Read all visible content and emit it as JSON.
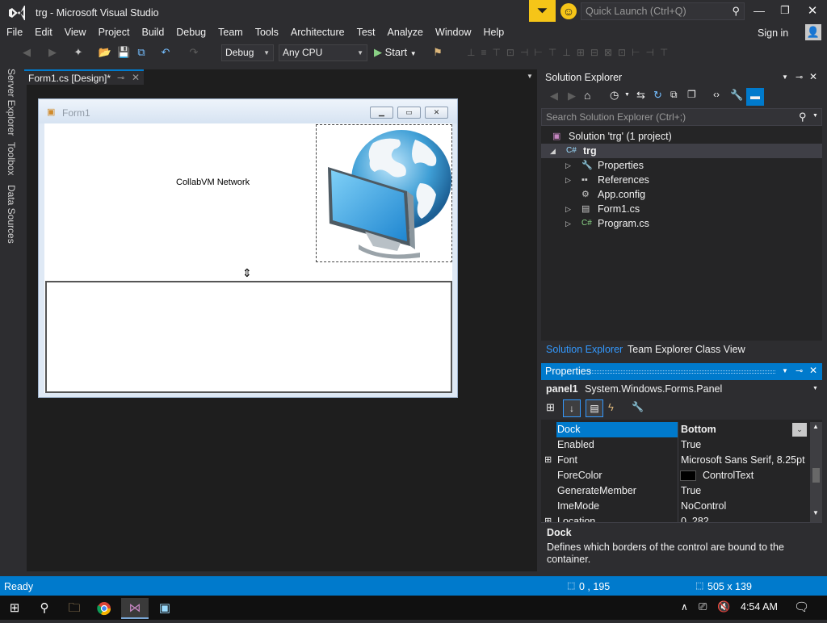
{
  "titlebar": {
    "app_title": "trg - Microsoft Visual Studio",
    "quick_launch_placeholder": "Quick Launch (Ctrl+Q)",
    "signin": "Sign in"
  },
  "menu": [
    "File",
    "Edit",
    "View",
    "Project",
    "Build",
    "Debug",
    "Team",
    "Tools",
    "Architecture",
    "Test",
    "Analyze",
    "Window",
    "Help"
  ],
  "toolbar": {
    "config": "Debug",
    "platform": "Any CPU",
    "start": "Start"
  },
  "left_tabs": [
    "Server Explorer",
    "Toolbox",
    "Data Sources"
  ],
  "document_tab": {
    "label": "Form1.cs [Design]*"
  },
  "form": {
    "title": "Form1",
    "label_text": "CollabVM Network"
  },
  "solution_explorer": {
    "title": "Solution Explorer",
    "search_placeholder": "Search Solution Explorer (Ctrl+;)",
    "solution": "Solution 'trg' (1 project)",
    "project": "trg",
    "items": [
      "Properties",
      "References",
      "App.config",
      "Form1.cs",
      "Program.cs"
    ],
    "tabs": [
      "Solution Explorer",
      "Team Explorer",
      "Class View"
    ]
  },
  "properties": {
    "title": "Properties",
    "object_name": "panel1",
    "object_type": "System.Windows.Forms.Panel",
    "rows": [
      {
        "name": "Dock",
        "value": "Bottom"
      },
      {
        "name": "Enabled",
        "value": "True"
      },
      {
        "name": "Font",
        "value": "Microsoft Sans Serif, 8.25pt"
      },
      {
        "name": "ForeColor",
        "value": "ControlText"
      },
      {
        "name": "GenerateMember",
        "value": "True"
      },
      {
        "name": "ImeMode",
        "value": "NoControl"
      },
      {
        "name": "Location",
        "value": "0, 282"
      }
    ],
    "desc_title": "Dock",
    "desc_text": "Defines which borders of the control are bound to the container."
  },
  "status": {
    "text": "Ready",
    "position": "0 , 195",
    "size": "505 x 139"
  },
  "taskbar": {
    "time": "4:54 AM"
  },
  "colors": {
    "accent": "#007acc",
    "background": "#2d2d30",
    "notify": "#f5c518"
  }
}
